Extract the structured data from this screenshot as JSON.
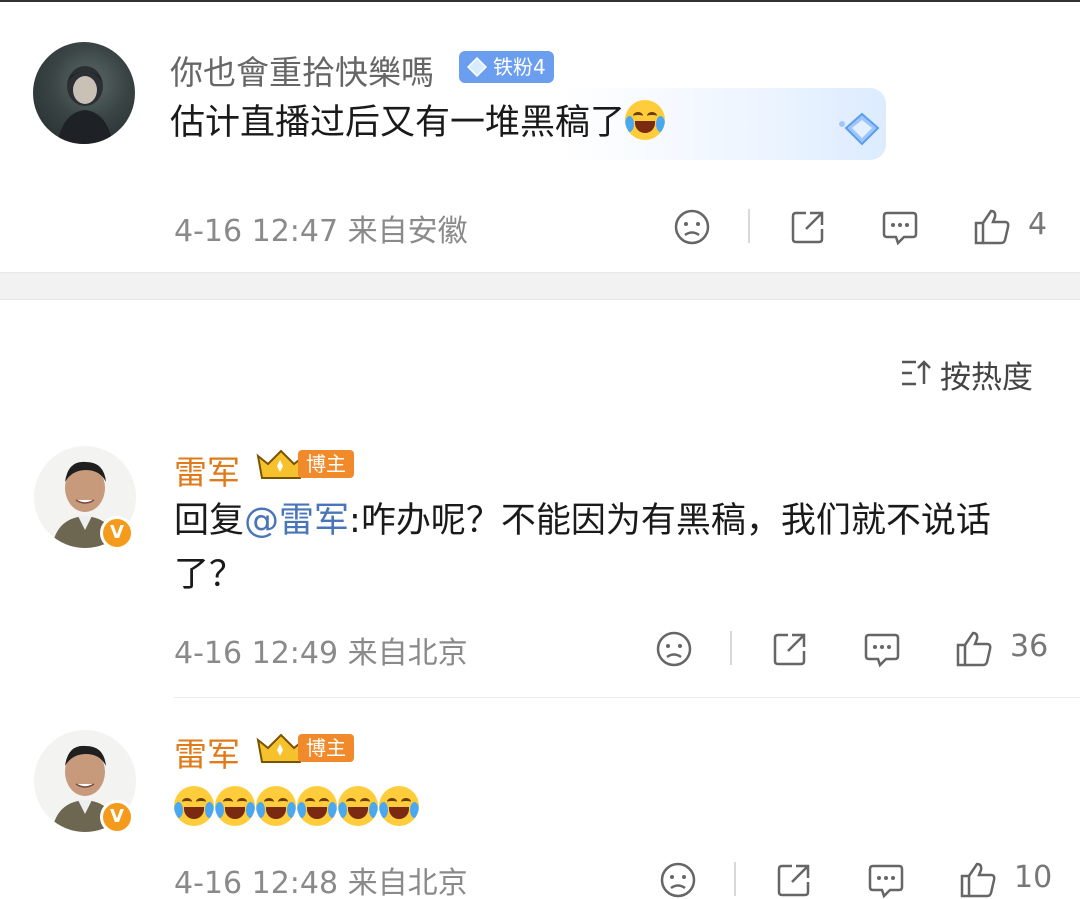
{
  "comments": [
    {
      "username": "你也會重拾快樂嗎",
      "badge": "铁粉4",
      "text": "估计直播过后又有一堆黑稿了",
      "meta": "4-16 12:47 来自安徽",
      "likes": "4"
    },
    {
      "username": "雷军",
      "badge": "博主",
      "reply_prefix": "回复",
      "mention": "@雷军",
      "text": ":咋办呢？不能因为有黑稿，我们就不说话了？",
      "meta": "4-16 12:49 来自北京",
      "likes": "36"
    },
    {
      "username": "雷军",
      "badge": "博主",
      "emoji_count": 6,
      "meta": "4-16 12:48 来自北京",
      "likes": "10"
    }
  ],
  "sort": {
    "label": "按热度"
  },
  "icons": [
    "sad-icon",
    "share-icon",
    "comment-icon",
    "like-icon",
    "sort-icon",
    "v-verified-icon",
    "crown-icon",
    "diamond-icon",
    "laugh-cry-emoji"
  ],
  "colors": {
    "username_grey": "#666666",
    "username_host": "#e07b1c",
    "mention": "#4a76b8",
    "fan_badge": "#6c9ef0",
    "host_badge": "#f08a2a"
  }
}
